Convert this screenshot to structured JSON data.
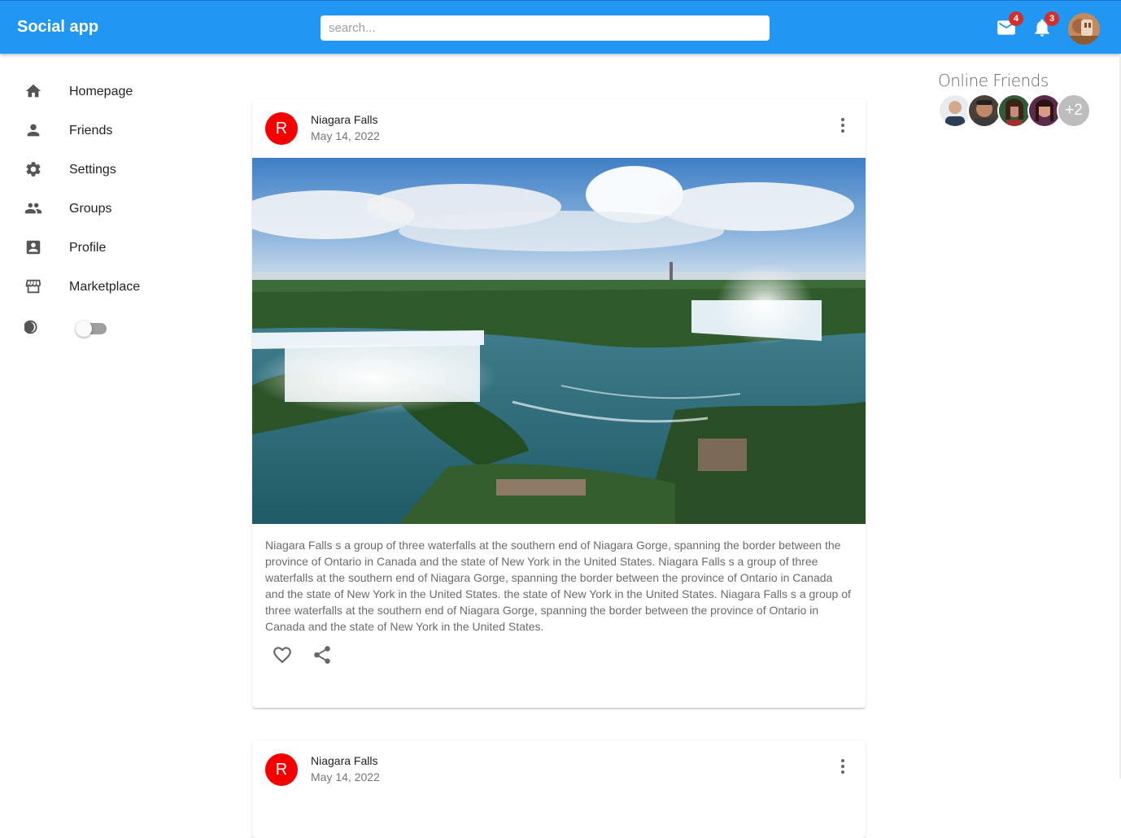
{
  "app": {
    "title": "Social app"
  },
  "search": {
    "placeholder": "search..."
  },
  "header": {
    "mail_icon": "mail-icon",
    "mail_badge": "4",
    "notifications_icon": "bell-icon",
    "notifications_badge": "3",
    "avatar_icon": "user-avatar"
  },
  "sidebar": {
    "items": [
      {
        "label": "Homepage",
        "icon": "home-icon"
      },
      {
        "label": "Friends",
        "icon": "person-icon"
      },
      {
        "label": "Settings",
        "icon": "gear-icon"
      },
      {
        "label": "Groups",
        "icon": "groups-icon"
      },
      {
        "label": "Profile",
        "icon": "account-box-icon"
      },
      {
        "label": "Marketplace",
        "icon": "storefront-icon"
      }
    ],
    "dark_mode": {
      "icon": "moon-icon",
      "enabled": false
    }
  },
  "posts": [
    {
      "avatar_letter": "R",
      "title": "Niagara Falls",
      "date": "May 14, 2022",
      "body": "Niagara Falls s a group of three waterfalls at the southern end of Niagara Gorge, spanning the border between the province of Ontario in Canada and the state of New York in the United States. Niagara Falls s a group of three waterfalls at the southern end of Niagara Gorge, spanning the border between the province of Ontario in Canada and the state of New York in the United States. the state of New York in the United States. Niagara Falls s a group of three waterfalls at the southern end of Niagara Gorge, spanning the border between the province of Ontario in Canada and the state of New York in the United States."
    },
    {
      "avatar_letter": "R",
      "title": "Niagara Falls",
      "date": "May 14, 2022"
    }
  ],
  "online_friends": {
    "title": "Online Friends",
    "more_count": "+2"
  },
  "colors": {
    "appbar": "#2196f3",
    "badge": "#d32f2f",
    "post_avatar": "#f50000"
  }
}
